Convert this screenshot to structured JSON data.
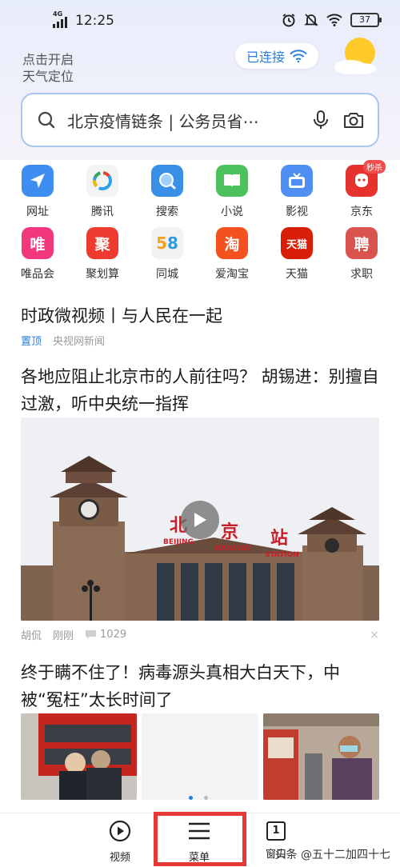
{
  "status_bar": {
    "network": "4G",
    "time": "12:25",
    "battery": "37"
  },
  "weather": {
    "line1": "点击开启",
    "line2": "天气定位"
  },
  "wifi": {
    "label": "已连接"
  },
  "search": {
    "query": "北京疫情链条 | 公务员省⋯"
  },
  "apps": [
    {
      "label": "网址",
      "icon": "navigation-arrow-icon",
      "color": "#3d8ef0"
    },
    {
      "label": "腾讯",
      "icon": "tencent-news-icon",
      "color": "#ffffff"
    },
    {
      "label": "搜索",
      "icon": "search-icon",
      "color": "#3a8fe6"
    },
    {
      "label": "小说",
      "icon": "book-icon",
      "color": "#4cc25e"
    },
    {
      "label": "影视",
      "icon": "tv-icon",
      "color": "#4f8ef2"
    },
    {
      "label": "京东",
      "icon": "jd-dog-icon",
      "color": "#e5322d",
      "badge": "秒杀"
    },
    {
      "label": "唯品会",
      "icon": "vip-icon",
      "color": "#f2387c",
      "glyph": "唯"
    },
    {
      "label": "聚划算",
      "icon": "juhuasuan-icon",
      "color": "#ef3b2f",
      "glyph": "聚"
    },
    {
      "label": "同城",
      "icon": "58-icon",
      "color": "#f2f2f2",
      "glyph": "58"
    },
    {
      "label": "爱淘宝",
      "icon": "taobao-icon",
      "color": "#f4511e",
      "glyph": "淘"
    },
    {
      "label": "天猫",
      "icon": "tmall-icon",
      "color": "#d81e06",
      "glyph": "天猫"
    },
    {
      "label": "求职",
      "icon": "job-icon",
      "color": "#d9534f",
      "glyph": "聘"
    }
  ],
  "feed": {
    "pinned": {
      "title": "时政微视频丨与人民在一起",
      "tag": "置顶",
      "source": "央视网新闻"
    },
    "video_article": {
      "title": "各地应阻止北京市的人前往吗？ 胡锡进：别擅自过激，听中央统一指挥",
      "source": "胡侃",
      "time": "刚刚",
      "comments": "1029",
      "image_signs": [
        "北",
        "京",
        "站",
        "BEIJING",
        "RAILWAY",
        "STATION"
      ]
    },
    "gallery_article": {
      "title": "终于瞒不住了！病毒源头真相大白天下，中被“冤枉”太长时间了"
    }
  },
  "bottom_nav": {
    "video": "视频",
    "menu": "菜单",
    "windows": "窗口",
    "window_count": "1"
  },
  "watermark": "头条 @五十二加四十七",
  "colors": {
    "accent": "#2b7ddb",
    "highlight": "#e53935"
  }
}
